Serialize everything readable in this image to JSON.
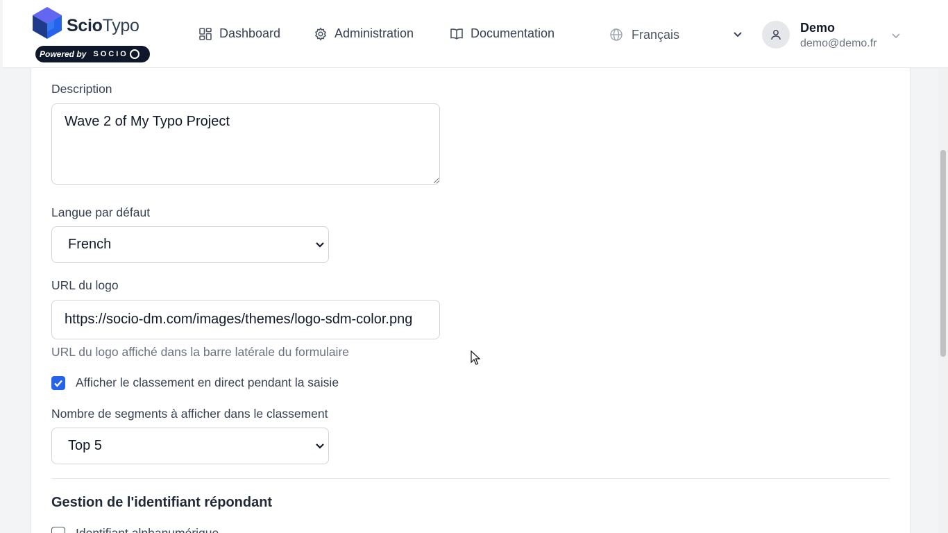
{
  "brand": {
    "name_bold": "Scio",
    "name_light": "Typo",
    "powered_by": "Powered by",
    "socio_logo_text": "SOCIO",
    "colors": {
      "cube_dark": "#1e3a8a",
      "cube_mid": "#2563eb",
      "cube_light": "#6366f1"
    }
  },
  "nav": {
    "dashboard": {
      "label": "Dashboard",
      "icon": "grid-icon"
    },
    "administration": {
      "label": "Administration",
      "icon": "gear-icon"
    },
    "documentation": {
      "label": "Documentation",
      "icon": "book-icon"
    }
  },
  "language": {
    "label": "Français",
    "icon": "globe-icon"
  },
  "user": {
    "name": "Demo",
    "email": "demo@demo.fr",
    "icon": "user-icon"
  },
  "form": {
    "description": {
      "label": "Description",
      "value": "Wave 2 of My Typo Project"
    },
    "default_language": {
      "label": "Langue par défaut",
      "selected": "French"
    },
    "logo_url": {
      "label": "URL du logo",
      "value": "https://socio-dm.com/images/themes/logo-sdm-color.png",
      "help": "URL du logo affiché dans la barre latérale du formulaire"
    },
    "live_ranking": {
      "label": "Afficher le classement en direct pendant la saisie",
      "checked": true
    },
    "segments": {
      "label": "Nombre de segments à afficher dans le classement",
      "selected": "Top 5"
    },
    "respondent_section": {
      "title": "Gestion de l'identifiant répondant"
    },
    "alphanumeric_id": {
      "label": "Identifiant alphanumérique",
      "checked": false
    }
  },
  "theme": {
    "accent": "#2563eb"
  }
}
